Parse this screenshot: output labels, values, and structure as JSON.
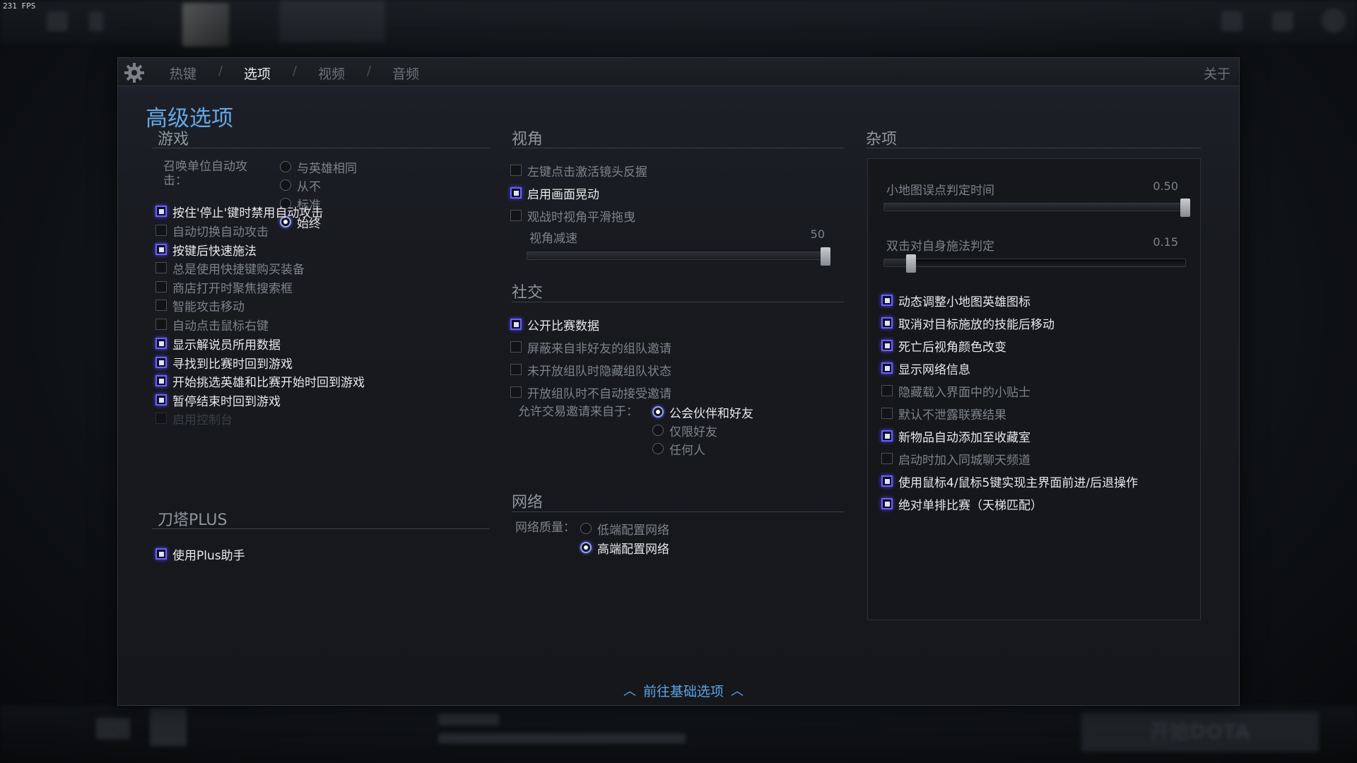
{
  "fps": "231 FPS",
  "tabs": {
    "hotkeys": "热键",
    "options": "选项",
    "video": "视频",
    "audio": "音频",
    "sep": "/",
    "about": "关于"
  },
  "page_title": "高级选项",
  "game": {
    "title": "游戏",
    "summon_label": "召唤单位自动攻击：",
    "summon_options": [
      "与英雄相同",
      "从不",
      "标准",
      "始终"
    ],
    "summon_selected": "始终",
    "checkboxes": [
      {
        "label": "按住'停止'键时禁用自动攻击",
        "checked": true
      },
      {
        "label": "自动切换自动攻击",
        "checked": false
      },
      {
        "label": "按键后快速施法",
        "checked": true
      },
      {
        "label": "总是使用快捷键购买装备",
        "checked": false
      },
      {
        "label": "商店打开时聚焦搜索框",
        "checked": false
      },
      {
        "label": "智能攻击移动",
        "checked": false
      },
      {
        "label": "自动点击鼠标右键",
        "checked": false
      },
      {
        "label": "显示解说员所用数据",
        "checked": true
      },
      {
        "label": "寻找到比赛时回到游戏",
        "checked": true
      },
      {
        "label": "开始挑选英雄和比赛开始时回到游戏",
        "checked": true
      },
      {
        "label": "暂停结束时回到游戏",
        "checked": true
      },
      {
        "label": "启用控制台",
        "checked": false,
        "disabled": true
      }
    ]
  },
  "plus": {
    "title": "刀塔PLUS",
    "checkboxes": [
      {
        "label": "使用Plus助手",
        "checked": true
      }
    ]
  },
  "camera": {
    "title": "视角",
    "checkboxes": [
      {
        "label": "左键点击激活镜头反握",
        "checked": false
      },
      {
        "label": "启用画面晃动",
        "checked": true
      },
      {
        "label": "观战时视角平滑拖曳",
        "checked": false
      }
    ],
    "slider": {
      "label": "视角减速",
      "value": "50",
      "fraction": 1.0
    }
  },
  "social": {
    "title": "社交",
    "checkboxes": [
      {
        "label": "公开比赛数据",
        "checked": true
      },
      {
        "label": "屏蔽来自非好友的组队邀请",
        "checked": false
      },
      {
        "label": "未开放组队时隐藏组队状态",
        "checked": false
      },
      {
        "label": "开放组队时不自动接受邀请",
        "checked": false
      }
    ],
    "trade_label": "允许交易邀请来自于：",
    "trade_options": [
      "公会伙伴和好友",
      "仅限好友",
      "任何人"
    ],
    "trade_selected": "公会伙伴和好友"
  },
  "network": {
    "title": "网络",
    "quality_label": "网络质量：",
    "options": [
      "低端配置网络",
      "高端配置网络"
    ],
    "selected": "高端配置网络"
  },
  "misc": {
    "title": "杂项",
    "sliders": [
      {
        "label": "小地图误点判定时间",
        "value": "0.50",
        "fraction": 1.0
      },
      {
        "label": "双击对自身施法判定",
        "value": "0.15",
        "fraction": 0.09
      }
    ],
    "checkboxes": [
      {
        "label": "动态调整小地图英雄图标",
        "checked": true
      },
      {
        "label": "取消对目标施放的技能后移动",
        "checked": true
      },
      {
        "label": "死亡后视角颜色改变",
        "checked": true
      },
      {
        "label": "显示网络信息",
        "checked": true
      },
      {
        "label": "隐藏载入界面中的小贴士",
        "checked": false
      },
      {
        "label": "默认不泄露联赛结果",
        "checked": false
      },
      {
        "label": "新物品自动添加至收藏室",
        "checked": true
      },
      {
        "label": "启动时加入同城聊天频道",
        "checked": false
      },
      {
        "label": "使用鼠标4/鼠标5键实现主界面前进/后退操作",
        "checked": true
      },
      {
        "label": "绝对单排比赛（天梯匹配）",
        "checked": true
      }
    ]
  },
  "footer": {
    "go_basic": "前往基础选项"
  },
  "background": {
    "play_button": "开始DOTA"
  },
  "colors": {
    "accent": "#64a7e4",
    "checkbox_on": "#6a60ff"
  }
}
